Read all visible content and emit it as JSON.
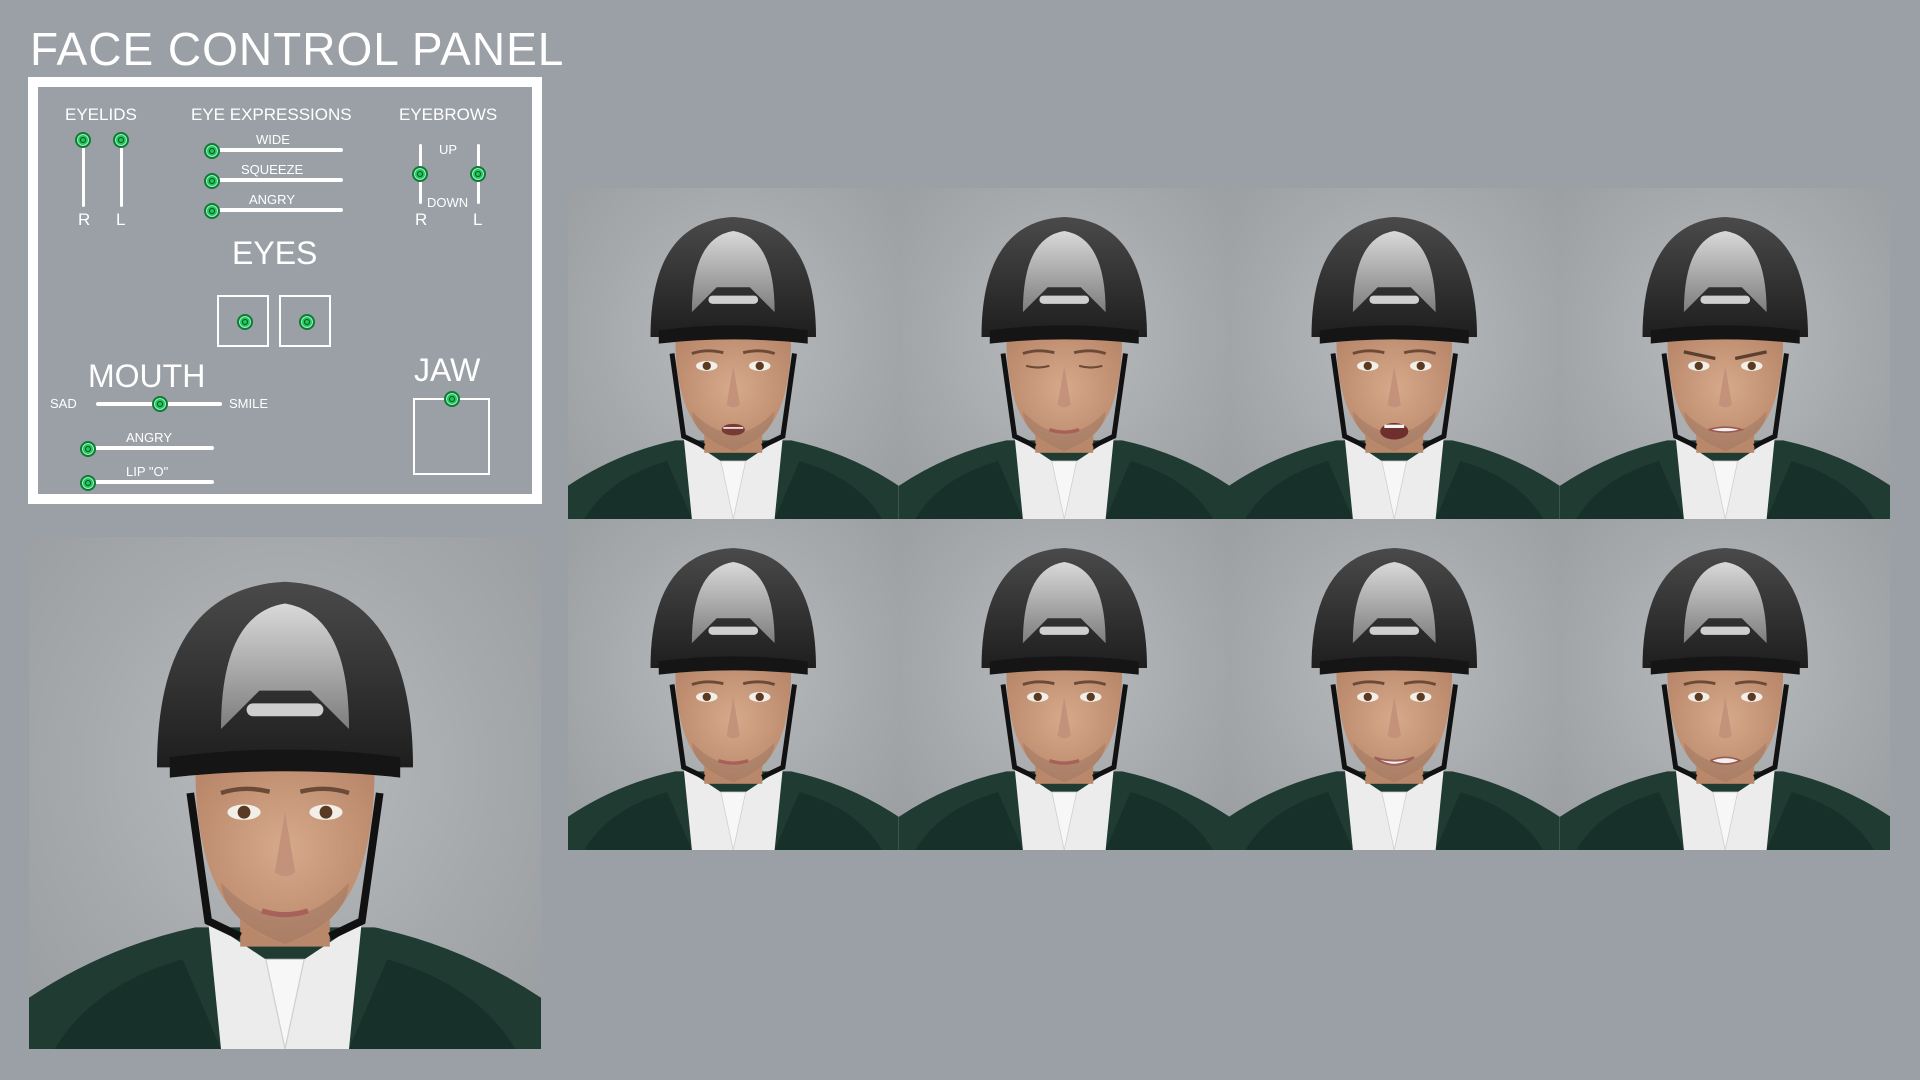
{
  "title": "FACE CONTROL PANEL",
  "panel": {
    "eyelids": {
      "label": "EYELIDS",
      "right": "R",
      "left": "L"
    },
    "eye_expressions": {
      "label": "EYE EXPRESSIONS",
      "sliders": [
        {
          "label": "WIDE",
          "value": 0
        },
        {
          "label": "SQUEEZE",
          "value": 0
        },
        {
          "label": "ANGRY",
          "value": 0
        }
      ]
    },
    "eyebrows": {
      "label": "EYEBROWS",
      "up": "UP",
      "down": "DOWN",
      "right": "R",
      "left": "L"
    },
    "eyes": {
      "label": "EYES"
    },
    "mouth": {
      "label": "MOUTH",
      "sad": "SAD",
      "smile": "SMILE",
      "sad_smile_value": 0.5,
      "angry": "ANGRY",
      "lip_o": "LIP \"O\""
    },
    "jaw": {
      "label": "JAW"
    }
  },
  "colors": {
    "background": "#9aa0a6",
    "knob": "#22c55e",
    "panel_border": "#ffffff",
    "jacket": "#1f3b32",
    "helmet": "#2a2a2a"
  },
  "expressions": [
    {
      "name": "talk"
    },
    {
      "name": "eyes-closed"
    },
    {
      "name": "surprised"
    },
    {
      "name": "angry"
    },
    {
      "name": "neutral"
    },
    {
      "name": "neutral-2"
    },
    {
      "name": "smile"
    },
    {
      "name": "grimace"
    }
  ]
}
